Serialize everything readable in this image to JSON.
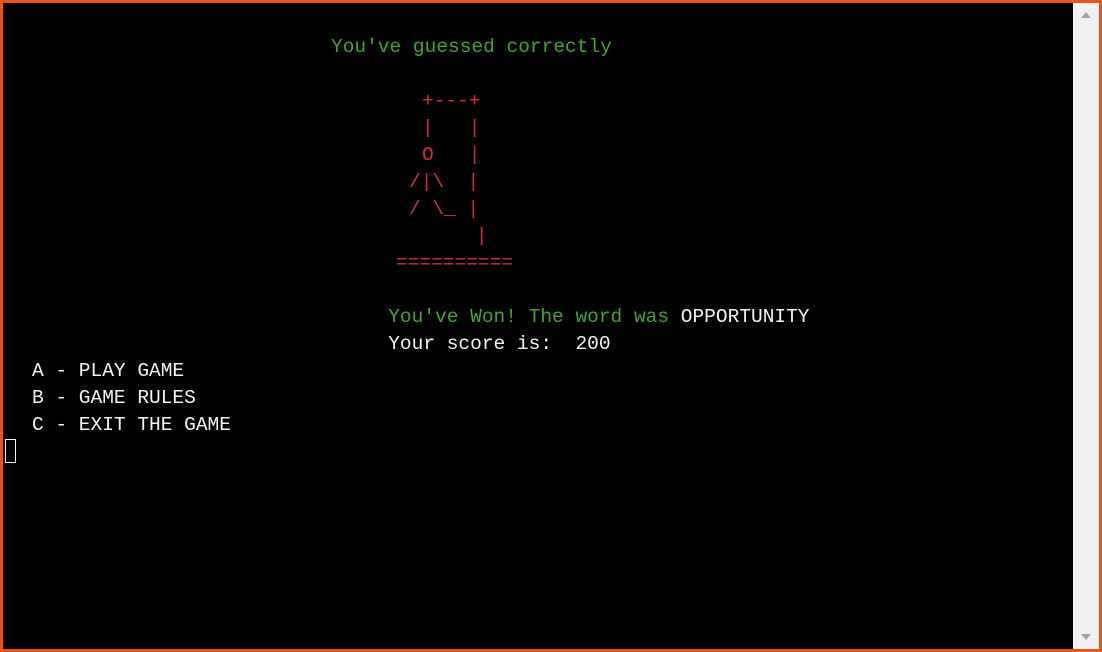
{
  "terminal": {
    "status_message": "You've guessed correctly",
    "hangman_art": [
      "+---+",
      "|   |",
      "O   |",
      "/|\\  |",
      "/ \\_ |",
      "    |",
      "=========="
    ],
    "result": {
      "prefix": "You've Won! The word was ",
      "word": "OPPORTUNITY"
    },
    "score": {
      "label": "Your score is:  ",
      "value": "200"
    },
    "menu": [
      "A - PLAY GAME",
      "B - GAME RULES",
      "C - EXIT THE GAME"
    ]
  },
  "colors": {
    "success_text": "#3fa52f",
    "hangman_art": "#d32f2f",
    "normal_text": "#f2f2f2",
    "frame_border": "#e8561e",
    "background": "#000000"
  },
  "icons": {
    "scroll_up": "triangle-up-icon",
    "scroll_down": "triangle-down-icon"
  }
}
